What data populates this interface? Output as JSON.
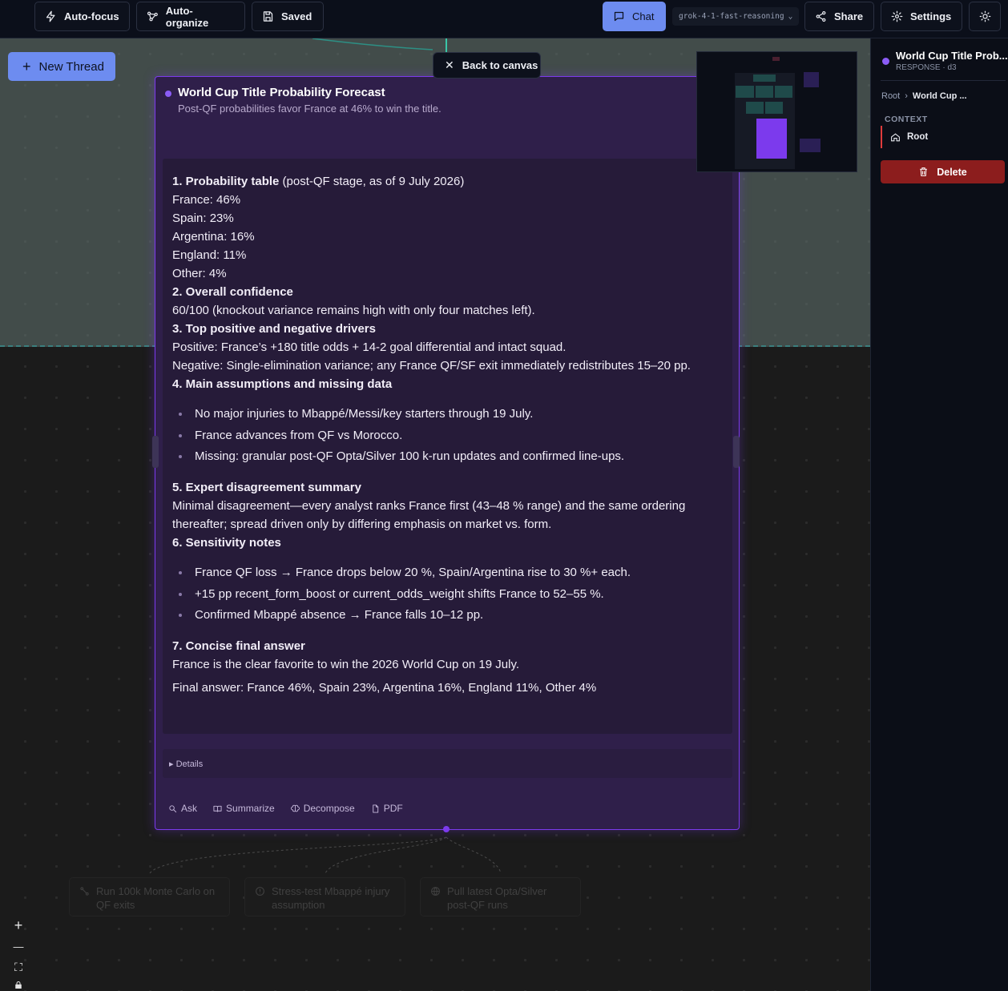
{
  "toolbar": {
    "auto_focus": "Auto-focus",
    "auto_organize": "Auto-organize",
    "saved": "Saved",
    "chat": "Chat",
    "model": "grok-4-1-fast-reasoning",
    "share": "Share",
    "settings": "Settings"
  },
  "canvas": {
    "new_thread": "New Thread",
    "back_to_canvas": "Back to canvas"
  },
  "card": {
    "title": "World Cup Title Probability Forecast",
    "subtitle": "Post-QF probabilities favor France at 46% to win the title.",
    "s1_head": "1. Probability table",
    "s1_tail": " (post-QF stage, as of 9 July 2026)",
    "probs": [
      "France: 46%",
      "Spain: 23%",
      "Argentina: 16%",
      "England: 11%",
      "Other: 4%"
    ],
    "s2_head": "2. Overall confidence",
    "s2_body": "60/100 (knockout variance remains high with only four matches left).",
    "s3_head": "3. Top positive and negative drivers",
    "s3_pos": "Positive: France’s +180 title odds + 14-2 goal differential and intact squad.",
    "s3_neg": "Negative: Single-elimination variance; any France QF/SF exit immediately redistributes 15–20 pp.",
    "s4_head": "4. Main assumptions and missing data",
    "s4_items": [
      "No major injuries to Mbappé/Messi/key starters through 19 July.",
      "France advances from QF vs Morocco.",
      "Missing: granular post-QF Opta/Silver 100 k-run updates and confirmed line-ups."
    ],
    "s5_head": "5. Expert disagreement summary",
    "s5_body": "Minimal disagreement—every analyst ranks France first (43–48 % range) and the same ordering thereafter; spread driven only by differing emphasis on market vs. form.",
    "s6_head": "6. Sensitivity notes",
    "s6_items": [
      "France QF loss → France drops below 20 %, Spain/Argentina rise to 30 %+ each.",
      "+15 pp recent_form_boost or current_odds_weight shifts France to 52–55 %.",
      "Confirmed Mbappé absence → France falls 10–12 pp."
    ],
    "s7_head": "7. Concise final answer",
    "s7_body": "France is the clear favorite to win the 2026 World Cup on 19 July.",
    "final": "Final answer: France 46%, Spain 23%, Argentina 16%, England 11%, Other 4%",
    "details": "▸ Details",
    "actions": {
      "ask": "Ask",
      "summarize": "Summarize",
      "decompose": "Decompose",
      "pdf": "PDF"
    }
  },
  "ghost_nodes": [
    "Run 100k Monte Carlo on QF exits",
    "Stress-test Mbappé injury assumption",
    "Pull latest Opta/Silver post-QF runs"
  ],
  "zoom": {
    "in": "+",
    "out": "—",
    "fit": "⛶"
  },
  "panel": {
    "title": "World Cup Title Prob...",
    "subtitle": "RESPONSE · d3",
    "crumb_root": "Root",
    "crumb_sep": "›",
    "crumb_current": "World Cup ...",
    "context_label": "CONTEXT",
    "context_item": "Root",
    "delete": "Delete"
  },
  "colors": {
    "accent": "#7c3aed",
    "chat_button": "#6d8cf0",
    "delete": "#8c1d1d"
  }
}
